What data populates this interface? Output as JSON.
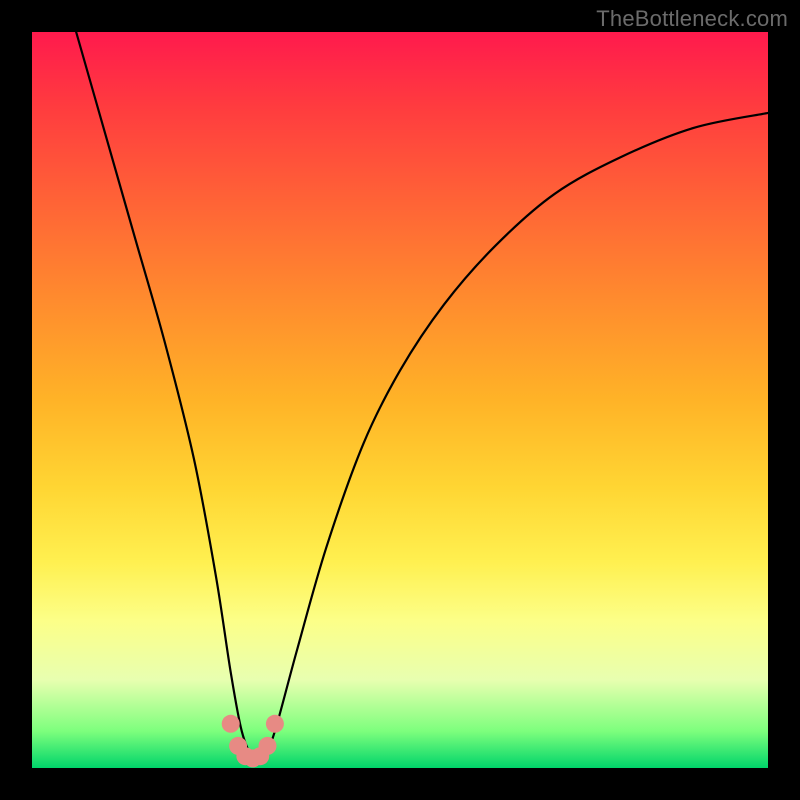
{
  "watermark": "TheBottleneck.com",
  "colors": {
    "frame": "#000000",
    "curve": "#000000",
    "marker_fill": "#e78a84",
    "marker_stroke": "#d46a63"
  },
  "chart_data": {
    "type": "line",
    "title": "",
    "xlabel": "",
    "ylabel": "",
    "xlim": [
      0,
      100
    ],
    "ylim": [
      0,
      100
    ],
    "grid": false,
    "legend": false,
    "series": [
      {
        "name": "bottleneck-curve",
        "x": [
          6,
          10,
          14,
          18,
          22,
          25,
          27,
          28.5,
          30,
          31.5,
          33,
          36,
          40,
          45,
          50,
          56,
          63,
          71,
          80,
          90,
          100
        ],
        "values": [
          100,
          86,
          72,
          58,
          42,
          26,
          13,
          5,
          1.5,
          1.5,
          5,
          16,
          30,
          44,
          54,
          63,
          71,
          78,
          83,
          87,
          89
        ]
      }
    ],
    "markers": {
      "name": "valley-markers",
      "x": [
        27.0,
        28.0,
        29.0,
        30.0,
        31.0,
        32.0,
        33.0
      ],
      "values": [
        6.0,
        3.0,
        1.6,
        1.3,
        1.6,
        3.0,
        6.0
      ]
    }
  }
}
